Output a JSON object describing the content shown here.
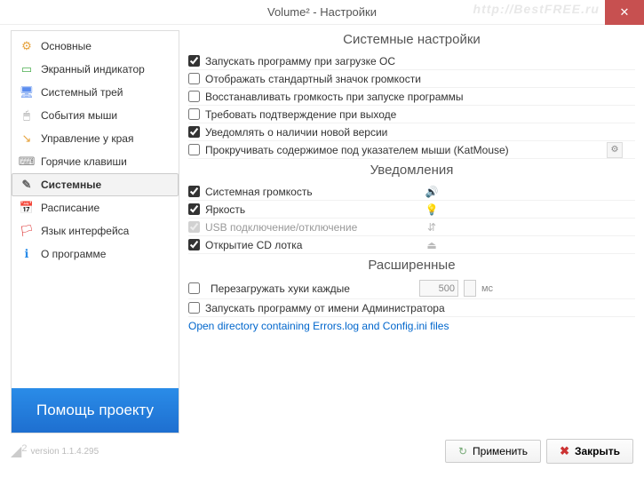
{
  "window": {
    "title": "Volume² - Настройки",
    "watermark": "http://BestFREE.ru"
  },
  "sidebar": {
    "items": [
      {
        "label": "Основные",
        "icon": "⚙",
        "color": "#e6a23c"
      },
      {
        "label": "Экранный индикатор",
        "icon": "▭",
        "color": "#4caf50"
      },
      {
        "label": "Системный трей",
        "icon": "🖥",
        "color": "#5b8def"
      },
      {
        "label": "События мыши",
        "icon": "🖱",
        "color": "#999"
      },
      {
        "label": "Управление у края",
        "icon": "↘",
        "color": "#e6a23c"
      },
      {
        "label": "Горячие клавиши",
        "icon": "⌨",
        "color": "#888"
      },
      {
        "label": "Системные",
        "icon": "✎",
        "color": "#666",
        "active": true
      },
      {
        "label": "Расписание",
        "icon": "📅",
        "color": "#4caf50"
      },
      {
        "label": "Язык интерфейса",
        "icon": "🏳",
        "color": "#d33"
      },
      {
        "label": "О программе",
        "icon": "ℹ",
        "color": "#2a8ce8"
      }
    ],
    "promo_line1": "Помощь проекту"
  },
  "content": {
    "system": {
      "title": "Системные настройки",
      "items": [
        {
          "label": "Запускать программу при загрузке ОС",
          "checked": true
        },
        {
          "label": "Отображать стандартный значок громкости",
          "checked": false
        },
        {
          "label": "Восстанавливать громкость при запуске программы",
          "checked": false
        },
        {
          "label": "Требовать подтверждение при выходе",
          "checked": false
        },
        {
          "label": "Уведомлять о наличии новой версии",
          "checked": true
        },
        {
          "label": "Прокручивать содержимое под указателем мыши (KatMouse)",
          "checked": false,
          "gear": true
        }
      ]
    },
    "notifications": {
      "title": "Уведомления",
      "items": [
        {
          "label": "Системная громкость",
          "checked": true,
          "icon": "🔊"
        },
        {
          "label": "Яркость",
          "checked": true,
          "icon": "💡"
        },
        {
          "label": "USB подключение/отключение",
          "checked": true,
          "disabled": true,
          "icon": "⇵"
        },
        {
          "label": "Открытие CD лотка",
          "checked": true,
          "icon": "⏏"
        }
      ]
    },
    "extended": {
      "title": "Расширенные",
      "reload_label": "Перезагружать хуки каждые",
      "reload_value": "500",
      "reload_unit": "мс",
      "admin_label": "Запускать программу от имени Администратора",
      "link": "Open directory containing Errors.log and Config.ini files"
    }
  },
  "footer": {
    "version_prefix": "2",
    "version": "version 1.1.4.295",
    "apply": "Применить",
    "close": "Закрыть"
  }
}
